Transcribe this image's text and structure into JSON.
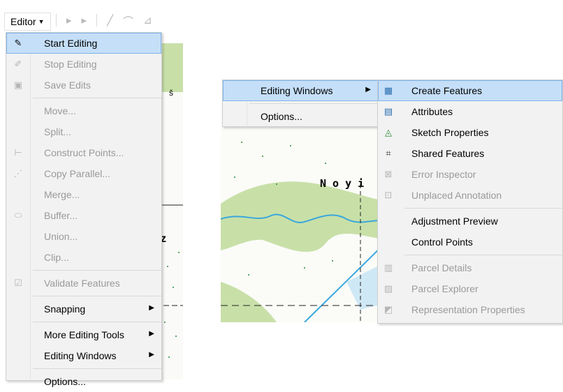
{
  "toolbar": {
    "editor_label": "Editor"
  },
  "map_left": {
    "label_top": "š",
    "label_bottom": "z"
  },
  "map_right": {
    "label": "N o y i"
  },
  "editor_menu": {
    "items": [
      {
        "label": "Start Editing",
        "icon": "pencil-icon",
        "state": "highlighted"
      },
      {
        "label": "Stop Editing",
        "icon": "stop-pencil-icon",
        "state": "disabled"
      },
      {
        "label": "Save Edits",
        "icon": "save-icon",
        "state": "disabled"
      },
      {
        "label": "Move...",
        "state": "disabled"
      },
      {
        "label": "Split...",
        "state": "disabled"
      },
      {
        "label": "Construct Points...",
        "icon": "construct-points-icon",
        "state": "disabled"
      },
      {
        "label": "Copy Parallel...",
        "icon": "copy-parallel-icon",
        "state": "disabled"
      },
      {
        "label": "Merge...",
        "state": "disabled"
      },
      {
        "label": "Buffer...",
        "icon": "buffer-icon",
        "state": "disabled"
      },
      {
        "label": "Union...",
        "state": "disabled"
      },
      {
        "label": "Clip...",
        "state": "disabled"
      },
      {
        "label": "Validate Features",
        "icon": "validate-icon",
        "state": "disabled"
      },
      {
        "label": "Snapping",
        "submenu": true
      },
      {
        "label": "More Editing Tools",
        "submenu": true
      },
      {
        "label": "Editing Windows",
        "submenu": true
      },
      {
        "label": "Options..."
      }
    ]
  },
  "editor_menu_right": {
    "items": [
      {
        "label": "Editing Windows",
        "state": "highlighted",
        "submenu": true
      },
      {
        "label": "Options..."
      }
    ]
  },
  "editing_windows_submenu": {
    "items": [
      {
        "label": "Create Features",
        "icon": "create-features-icon",
        "state": "highlighted"
      },
      {
        "label": "Attributes",
        "icon": "attributes-icon"
      },
      {
        "label": "Sketch Properties",
        "icon": "sketch-properties-icon"
      },
      {
        "label": "Shared Features",
        "icon": "shared-features-icon"
      },
      {
        "label": "Error Inspector",
        "icon": "error-inspector-icon",
        "state": "disabled"
      },
      {
        "label": "Unplaced Annotation",
        "icon": "unplaced-annotation-icon",
        "state": "disabled"
      },
      {
        "label": "Adjustment Preview"
      },
      {
        "label": "Control Points"
      },
      {
        "label": "Parcel Details",
        "icon": "parcel-details-icon",
        "state": "disabled"
      },
      {
        "label": "Parcel Explorer",
        "icon": "parcel-explorer-icon",
        "state": "disabled"
      },
      {
        "label": "Representation Properties",
        "icon": "representation-properties-icon",
        "state": "disabled"
      }
    ]
  },
  "colors": {
    "highlight": "#c5dff8",
    "highlight_border": "#7eb4ea",
    "menu_bg": "#f2f2f2",
    "disabled_text": "#9a9a9a",
    "map_green": "#c8e0a8",
    "map_water": "#3aa7dc",
    "map_light_water": "#cfe8f5"
  }
}
